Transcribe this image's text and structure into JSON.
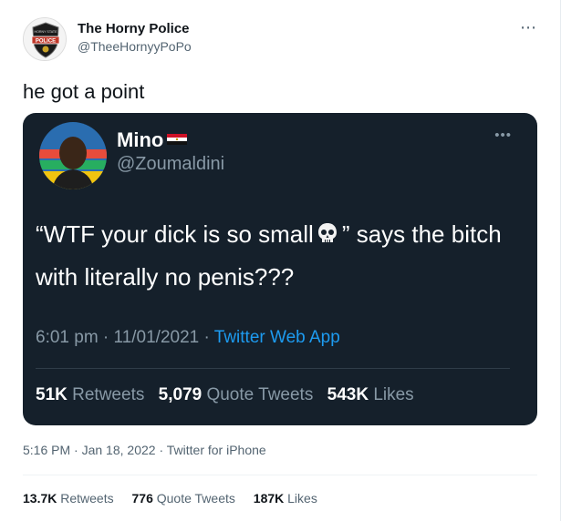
{
  "author": {
    "name": "The Horny Police",
    "handle": "@TheeHornyyPoPo",
    "badge_text": "POLICE",
    "badge_top_text": "HORNY STATE"
  },
  "tweet": {
    "text": "he got a point",
    "time": "5:16 PM",
    "date": "Jan 18, 2022",
    "source": "Twitter for iPhone",
    "stats": {
      "retweets_value": "13.7K",
      "retweets_label": "Retweets",
      "quotes_value": "776",
      "quotes_label": "Quote Tweets",
      "likes_value": "187K",
      "likes_label": "Likes"
    }
  },
  "embedded": {
    "name": "Mino",
    "handle": "@Zoumaldini",
    "text_part1": "“WTF your dick is so small",
    "text_part2": "” says the bitch with literally no penis???",
    "time": "6:01 pm",
    "date": "11/01/2021",
    "source": "Twitter Web App",
    "stats": {
      "retweets_value": "51K",
      "retweets_label": "Retweets",
      "quotes_value": "5,079",
      "quotes_label": "Quote Tweets",
      "likes_value": "543K",
      "likes_label": "Likes"
    },
    "icons": [
      "egypt-flag-icon",
      "skull-icon"
    ]
  },
  "colors": {
    "link": "#1d9bf0",
    "muted": "#536471",
    "embedded_bg": "#15202b"
  }
}
